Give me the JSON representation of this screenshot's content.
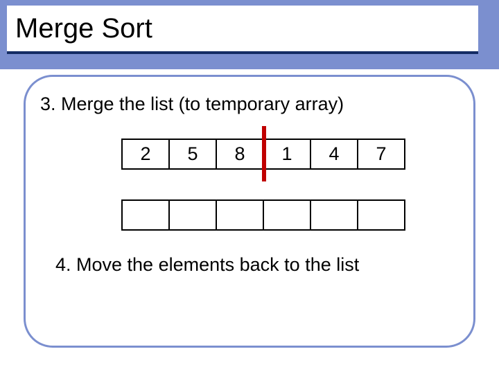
{
  "title": "Merge Sort",
  "step3_text": "3. Merge the list (to temporary array)",
  "step4_text": "4. Move the elements back to the list",
  "top_array": [
    "2",
    "5",
    "8",
    "1",
    "4",
    "7"
  ],
  "bottom_array": [
    "",
    "",
    "",
    "",
    "",
    ""
  ],
  "colors": {
    "band": "#7b8fcf",
    "title_underline": "#142c64",
    "divider": "#c00000"
  }
}
